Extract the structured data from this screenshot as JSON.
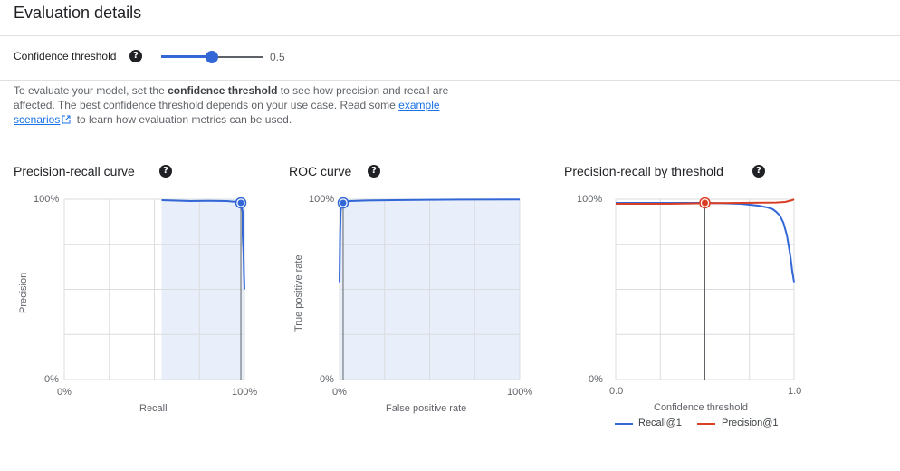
{
  "header": {
    "title": "Evaluation details"
  },
  "threshold": {
    "label": "Confidence threshold",
    "value": 0.5,
    "value_text": "0.5",
    "help_icon": "help-circle-icon"
  },
  "description": {
    "text_1": "To evaluate your model, set the ",
    "bold": "confidence threshold",
    "text_2": " to see how precision and recall are affected. The best confidence threshold depends on your use case. Read some ",
    "link_text": "example scenarios",
    "link_icon": "external-link-icon",
    "text_3": " to learn how evaluation metrics can be used."
  },
  "colors": {
    "accent": "#3367d6",
    "recall": "#3367d6",
    "precision": "#d93f25",
    "fill": "#e8eefa"
  },
  "chart_data": [
    {
      "type": "area",
      "title": "Precision-recall curve",
      "xlabel": "Recall",
      "ylabel": "Precision",
      "xticks": [
        "0%",
        "100%"
      ],
      "yticks": [
        "0%",
        "100%"
      ],
      "xlim": [
        0,
        1
      ],
      "ylim": [
        0,
        1
      ],
      "grid": true,
      "x": [
        0.54,
        0.6,
        0.7,
        0.8,
        0.9,
        0.96,
        0.98,
        0.99,
        0.99,
        0.995,
        0.997,
        1.0
      ],
      "y": [
        0.995,
        0.993,
        0.99,
        0.991,
        0.99,
        0.985,
        0.98,
        0.93,
        0.8,
        0.7,
        0.6,
        0.5
      ],
      "marker": {
        "x": 0.98,
        "y": 0.98
      }
    },
    {
      "type": "area",
      "title": "ROC curve",
      "xlabel": "False positive rate",
      "ylabel": "True positive rate",
      "xticks": [
        "0%",
        "100%"
      ],
      "yticks": [
        "0%",
        "100%"
      ],
      "xlim": [
        0,
        1
      ],
      "ylim": [
        0,
        1
      ],
      "grid": true,
      "x": [
        0.0,
        0.003,
        0.006,
        0.01,
        0.015,
        0.03,
        0.06,
        0.15,
        0.3,
        0.5,
        0.7,
        1.0
      ],
      "y": [
        0.54,
        0.8,
        0.93,
        0.965,
        0.975,
        0.985,
        0.99,
        0.993,
        0.995,
        0.997,
        0.998,
        0.999
      ],
      "marker": {
        "x": 0.02,
        "y": 0.98
      }
    },
    {
      "type": "line",
      "title": "Precision-recall by threshold",
      "xlabel": "Confidence threshold",
      "ylabel": "",
      "xticks": [
        "0.0",
        "1.0"
      ],
      "yticks": [
        "0%",
        "100%"
      ],
      "xlim": [
        0,
        1
      ],
      "ylim": [
        0,
        1
      ],
      "grid": true,
      "legend": "bottom",
      "series": [
        {
          "name": "Recall@1",
          "x": [
            0.0,
            0.3,
            0.5,
            0.6,
            0.7,
            0.75,
            0.8,
            0.85,
            0.88,
            0.9,
            0.92,
            0.94,
            0.96,
            0.97,
            0.98,
            0.99,
            1.0
          ],
          "y": [
            0.98,
            0.98,
            0.98,
            0.978,
            0.975,
            0.97,
            0.965,
            0.955,
            0.945,
            0.93,
            0.91,
            0.87,
            0.8,
            0.74,
            0.68,
            0.6,
            0.54
          ]
        },
        {
          "name": "Precision@1",
          "x": [
            0.0,
            0.3,
            0.5,
            0.7,
            0.9,
            0.95,
            0.97,
            0.99,
            1.0
          ],
          "y": [
            0.975,
            0.975,
            0.978,
            0.98,
            0.982,
            0.985,
            0.99,
            0.995,
            1.0
          ]
        }
      ],
      "marker": {
        "x": 0.5,
        "y": 0.98
      }
    }
  ]
}
